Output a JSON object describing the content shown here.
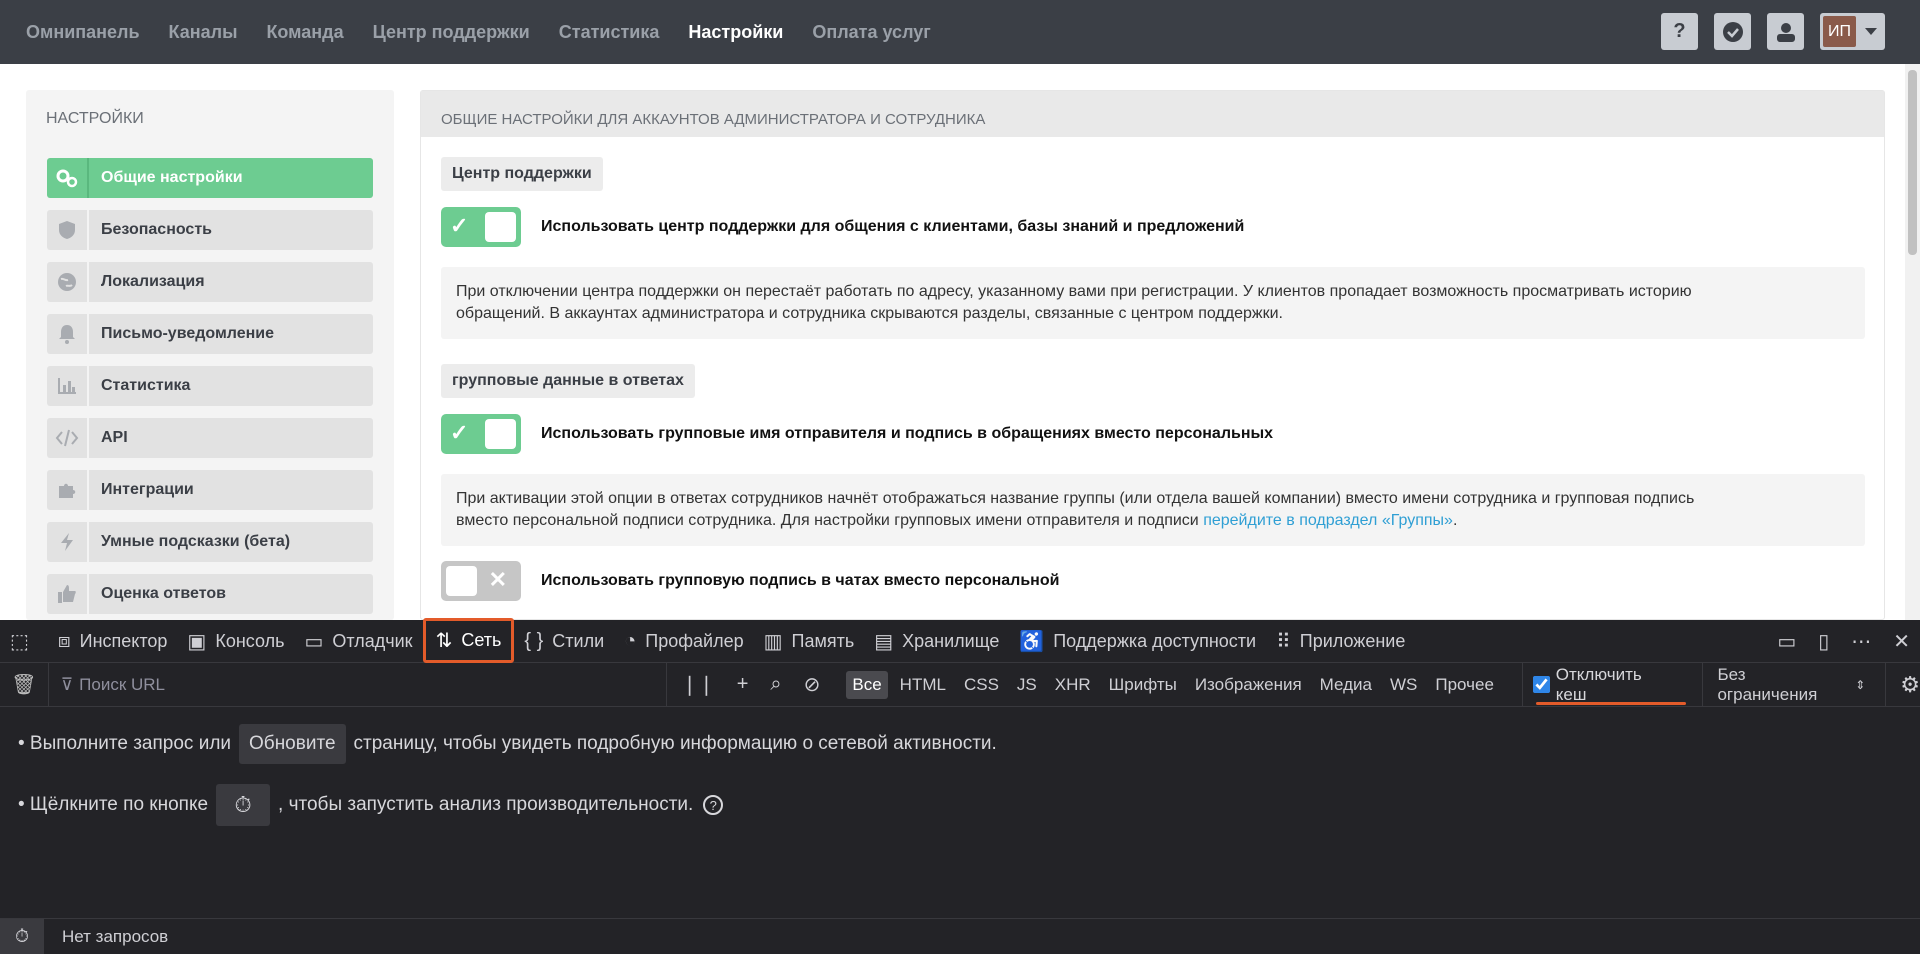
{
  "topnav": {
    "links": [
      "Омнипанель",
      "Каналы",
      "Команда",
      "Центр поддержки",
      "Статистика",
      "Настройки",
      "Оплата услуг"
    ],
    "active_link": "Настройки",
    "help_label": "?",
    "user_initials": "ИП"
  },
  "sidebar": {
    "header": "НАСТРОЙКИ",
    "items": [
      {
        "label": "Общие настройки",
        "icon": "gears-icon"
      },
      {
        "label": "Безопасность",
        "icon": "shield-icon"
      },
      {
        "label": "Локализация",
        "icon": "globe-icon"
      },
      {
        "label": "Письмо-уведомление",
        "icon": "bell-icon"
      },
      {
        "label": "Статистика",
        "icon": "bar-chart-icon"
      },
      {
        "label": "API",
        "icon": "code-icon"
      },
      {
        "label": "Интеграции",
        "icon": "puzzle-icon"
      },
      {
        "label": "Умные подсказки (бета)",
        "icon": "bolt-icon"
      },
      {
        "label": "Оценка ответов",
        "icon": "thumbs-up-icon"
      }
    ]
  },
  "main": {
    "header": "ОБЩИЕ НАСТРОЙКИ ДЛЯ АККАУНТОВ АДМИНИСТРАТОРА И СОТРУДНИКА",
    "section1": {
      "tag": "Центр поддержки",
      "toggle_label": "Использовать центр поддержки для общения с клиентами, базы знаний и предложений",
      "toggle_on": true,
      "note_line1": "При отключении центра поддержки он перестаёт работать по адресу, указанному вами при регистрации. У клиентов пропадает возможность просматривать историю",
      "note_line2": "обращений. В аккаунтах администратора и сотрудника скрываются разделы, связанные с центром поддержки."
    },
    "section2": {
      "tag": "групповые данные в ответах",
      "toggle_label": "Использовать групповые имя отправителя и подпись в обращениях вместо персональных",
      "toggle_on": true,
      "note_line1": "При активации этой опции в ответах сотрудников начнёт отображаться название группы (или отдела вашей компании) вместо имени сотрудника и групповая подпись",
      "note_line2_prefix": "вместо персональной подписи сотрудника. Для настройки групповых имени отправителя и подписи ",
      "note_link": "перейдите в подраздел «Группы»",
      "note_suffix": ".",
      "toggle2_label": "Использовать групповую подпись в чатах вместо персональной",
      "toggle2_on": false
    }
  },
  "devtools": {
    "tabs": [
      {
        "label": "Инспектор",
        "icon": "inspector-icon"
      },
      {
        "label": "Консоль",
        "icon": "console-icon"
      },
      {
        "label": "Отладчик",
        "icon": "debugger-icon"
      },
      {
        "label": "Сеть",
        "icon": "network-icon"
      },
      {
        "label": "Стили",
        "icon": "styles-icon"
      },
      {
        "label": "Профайлер",
        "icon": "profiler-icon"
      },
      {
        "label": "Память",
        "icon": "memory-icon"
      },
      {
        "label": "Хранилище",
        "icon": "storage-icon"
      },
      {
        "label": "Поддержка доступности",
        "icon": "accessibility-icon"
      },
      {
        "label": "Приложение",
        "icon": "application-icon"
      }
    ],
    "active_tab": "Сеть",
    "filter_placeholder": "Поиск URL",
    "types": [
      "Все",
      "HTML",
      "CSS",
      "JS",
      "XHR",
      "Шрифты",
      "Изображения",
      "Медиа",
      "WS",
      "Прочее"
    ],
    "active_type": "Все",
    "disable_cache_label": "Отключить кеш",
    "disable_cache_checked": true,
    "throttle_label": "Без ограничения",
    "hint1_prefix": "• Выполните запрос или",
    "hint1_button": "Обновите",
    "hint1_suffix": "страницу, чтобы увидеть подробную информацию о сетевой активности.",
    "hint2_prefix": "• Щёлкните по кнопке",
    "hint2_suffix": ", чтобы запустить анализ производительности.",
    "status_text": "Нет запросов"
  },
  "colors": {
    "accent_green": "#6dcc91",
    "nav_bg": "#3b3f46",
    "devtools_bg": "#232327",
    "highlight_orange": "#e35b2a",
    "link_blue": "#2f9fd4"
  }
}
